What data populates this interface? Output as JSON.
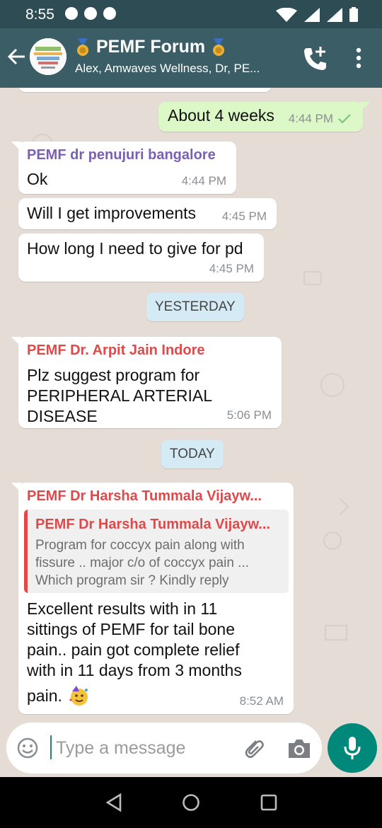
{
  "status_bar": {
    "time": "8:55"
  },
  "header": {
    "title": "PEMF Forum",
    "members": "Alex, Amwaves Wellness, Dr, PE..."
  },
  "messages": [
    {
      "direction": "out",
      "text": "About 4 weeks",
      "time": "4:44 PM",
      "status": "delivered"
    },
    {
      "direction": "in",
      "sender": "PEMF dr penujuri bangalore",
      "sender_color": "#7b5fb5",
      "text": "Ok",
      "time": "4:44 PM"
    },
    {
      "direction": "in",
      "text": "Will I get improvements",
      "time": "4:45 PM"
    },
    {
      "direction": "in",
      "text": "How long I need to give for pd",
      "time": "4:45 PM"
    },
    {
      "direction": "in",
      "sender": "PEMF Dr. Arpit Jain Indore",
      "sender_color": "#e0494a",
      "text_lines": [
        "Plz suggest program for",
        "PERIPHERAL ARTERIAL DISEASE"
      ],
      "time": "5:06 PM"
    },
    {
      "direction": "in",
      "sender": "PEMF Dr Harsha Tummala Vijayw...",
      "sender_color": "#e0494a",
      "quote": {
        "sender": "PEMF Dr Harsha Tummala Vijayw...",
        "lines": [
          "Program for coccyx pain along  with",
          "fissure .. major c/o of coccyx pain ...",
          "Which program sir ? Kindly reply"
        ]
      },
      "text_lines": [
        "Excellent results with in 11",
        "sittings of PEMF for tail bone",
        "pain.. pain got complete relief",
        "with in 11 days from 3 months",
        "pain."
      ],
      "time": "8:52 AM"
    }
  ],
  "date_chips": {
    "yesterday": "YESTERDAY",
    "today": "TODAY"
  },
  "composer": {
    "placeholder": "Type a message"
  },
  "colors": {
    "header": "#3b5d65",
    "status_bar": "#2e4c54",
    "accent": "#00897b",
    "outgoing_bubble": "#dcf8c6",
    "chat_bg": "#e5ddd5"
  }
}
